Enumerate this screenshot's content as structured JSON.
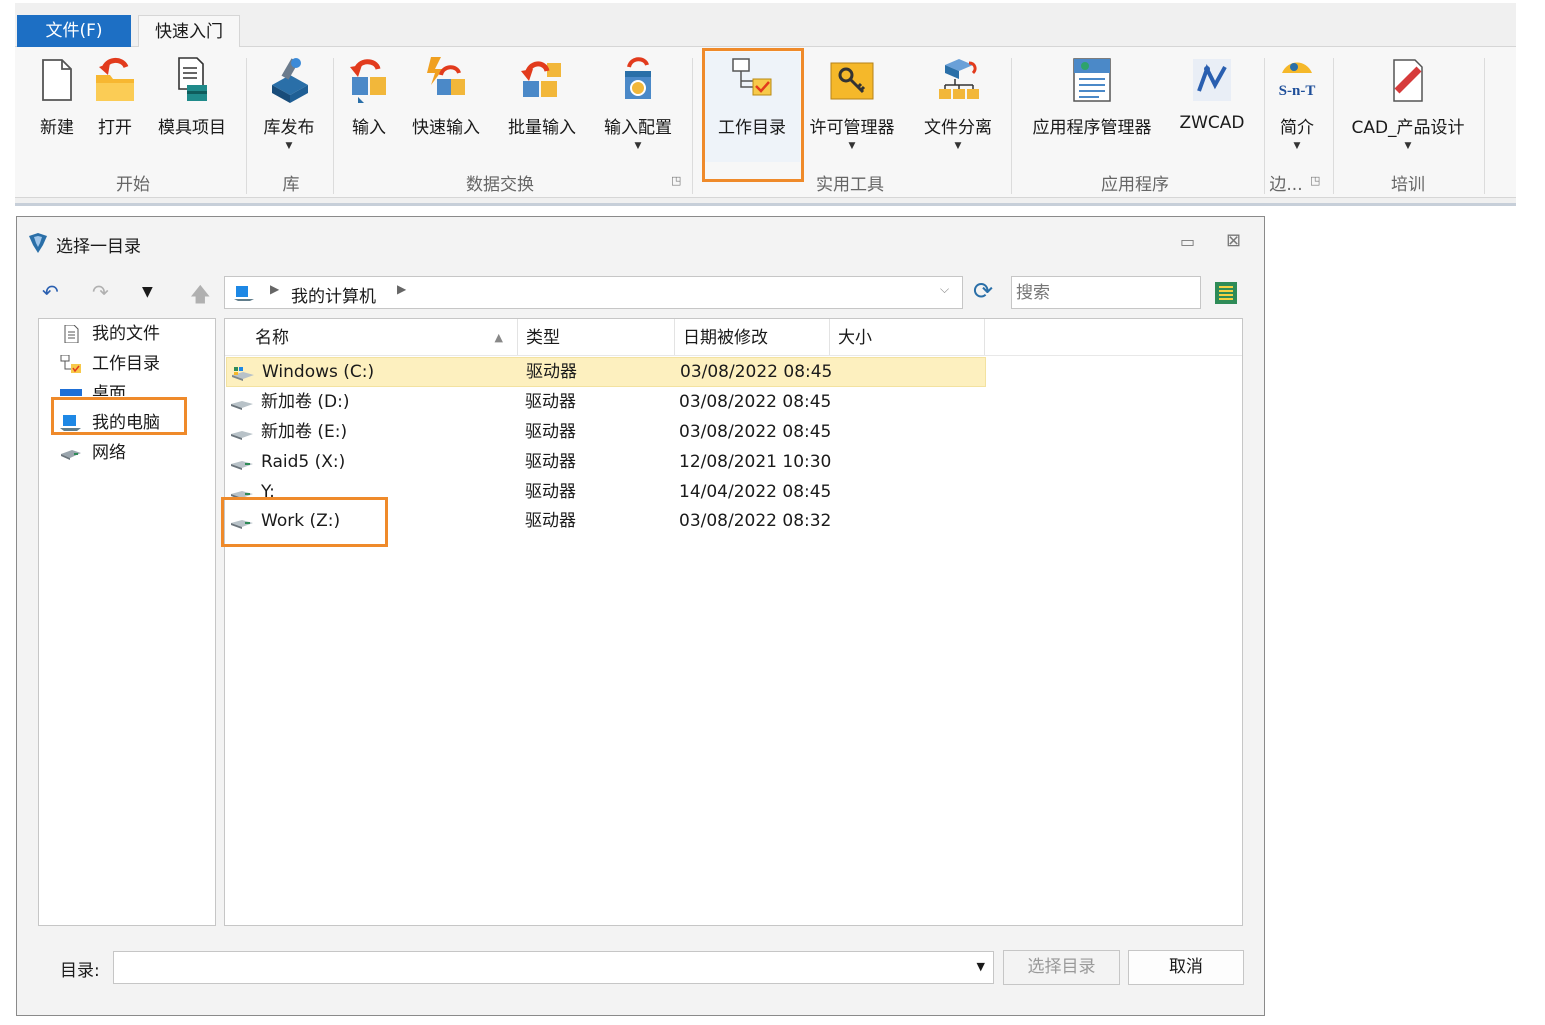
{
  "ribbon": {
    "tabs": [
      {
        "label": "文件(F)"
      },
      {
        "label": "快速入门"
      }
    ],
    "buttons": {
      "new": "新建",
      "open": "打开",
      "mold_project": "模具项目",
      "lib_publish": "库发布",
      "import": "输入",
      "quick_import": "快速输入",
      "batch_import": "批量输入",
      "import_config": "输入配置",
      "work_dir": "工作目录",
      "license_manager": "许可管理器",
      "file_split": "文件分离",
      "app_manager": "应用程序管理器",
      "zwcad": "ZWCAD",
      "intro": "简介",
      "cad_design": "CAD_产品设计"
    },
    "groups": {
      "start": "开始",
      "library": "库",
      "data_exchange": "数据交换",
      "utilities": "实用工具",
      "applications": "应用程序",
      "edge": "边...",
      "training": "培训"
    }
  },
  "dialog": {
    "title": "选择一目录",
    "breadcrumb": "我的计算机",
    "search_placeholder": "搜索",
    "nav": [
      {
        "label": "我的文件",
        "icon": "document-icon"
      },
      {
        "label": "工作目录",
        "icon": "work-folder-icon"
      },
      {
        "label": "桌面",
        "icon": "desktop-icon"
      },
      {
        "label": "我的电脑",
        "icon": "computer-icon"
      },
      {
        "label": "网络",
        "icon": "network-icon"
      }
    ],
    "columns": {
      "name": "名称",
      "type": "类型",
      "modified": "日期被修改",
      "size": "大小"
    },
    "files": [
      {
        "name": "Windows (C:)",
        "type": "驱动器",
        "modified": "03/08/2022 08:45",
        "size": ""
      },
      {
        "name": "新加卷 (D:)",
        "type": "驱动器",
        "modified": "03/08/2022 08:45",
        "size": ""
      },
      {
        "name": "新加卷 (E:)",
        "type": "驱动器",
        "modified": "03/08/2022 08:45",
        "size": ""
      },
      {
        "name": "Raid5 (X:)",
        "type": "驱动器",
        "modified": "12/08/2021 10:30",
        "size": ""
      },
      {
        "name": "Y:",
        "type": "驱动器",
        "modified": "14/04/2022 08:45",
        "size": ""
      },
      {
        "name": "Work (Z:)",
        "type": "驱动器",
        "modified": "03/08/2022 08:32",
        "size": ""
      }
    ],
    "selected_row": 0,
    "dir_label": "目录:",
    "dir_value": "",
    "select_button": "选择目录",
    "cancel_button": "取消"
  },
  "colors": {
    "accent": "#1d6fc4",
    "highlight": "#ef8a2a",
    "selected_row": "#fdf0bf"
  }
}
